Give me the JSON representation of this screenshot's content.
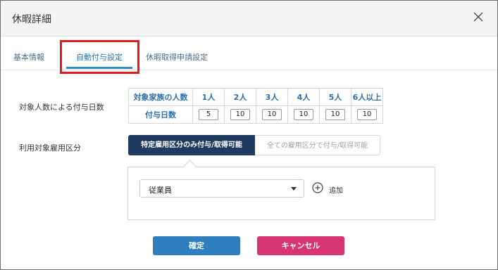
{
  "dialog": {
    "title": "休暇詳細"
  },
  "tabs": [
    {
      "label": "基本情報"
    },
    {
      "label": "自動付与設定"
    },
    {
      "label": "休暇取得申請設定"
    }
  ],
  "grant_days": {
    "row_label": "対象人数による付与日数",
    "header_label": "対象家族の人数",
    "columns": [
      "1人",
      "2人",
      "3人",
      "4人",
      "5人",
      "6人以上"
    ],
    "value_label": "付与日数",
    "values": [
      "5",
      "10",
      "10",
      "10",
      "10",
      "10"
    ]
  },
  "employment": {
    "label": "利用対象雇用区分",
    "options": [
      "特定雇用区分のみ付与/取得可能",
      "全ての雇用区分で付与/取得可能"
    ],
    "selected": "従業員",
    "add_label": "追加"
  },
  "buttons": {
    "ok": "確定",
    "cancel": "キャンセル"
  },
  "colors": {
    "primary": "#2f7fc0",
    "danger": "#d83472",
    "navy": "#1f3b61",
    "highlight": "#e21b1b"
  },
  "icons": [
    "close-icon",
    "chevron-down-icon",
    "plus-circle-icon"
  ]
}
